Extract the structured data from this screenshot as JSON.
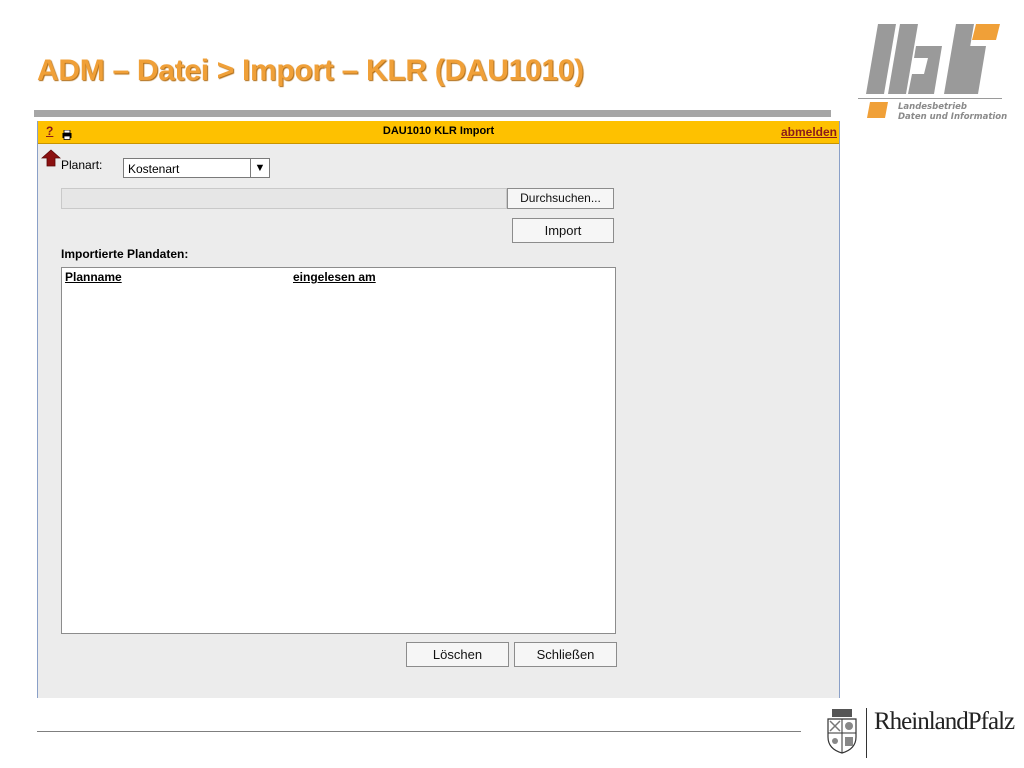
{
  "slide": {
    "title": "ADM – Datei > Import – KLR (DAU1010)",
    "logo_letters": "ldi",
    "logo_subtitle_line1": "Landesbetrieb",
    "logo_subtitle_line2": "Daten und Information",
    "footer_brand": "RheinlandPfalz"
  },
  "window": {
    "help_label": "?",
    "title": "DAU1010 KLR Import",
    "logout_label": "abmelden"
  },
  "form": {
    "planart_label": "Planart:",
    "planart_value": "Kostenart",
    "browse_label": "Durchsuchen...",
    "import_label": "Import",
    "imported_label": "Importierte Plandaten:",
    "columns": [
      "Planname",
      "eingelesen am"
    ],
    "rows": [],
    "delete_label": "Löschen",
    "close_label": "Schließen"
  },
  "colors": {
    "title_orange": "#f0a038",
    "titlebar_yellow": "#fec100",
    "link_red": "#8b1a1a"
  },
  "icons": [
    "help-icon",
    "printer-icon",
    "back-arrow-icon",
    "dropdown-arrow-icon"
  ]
}
